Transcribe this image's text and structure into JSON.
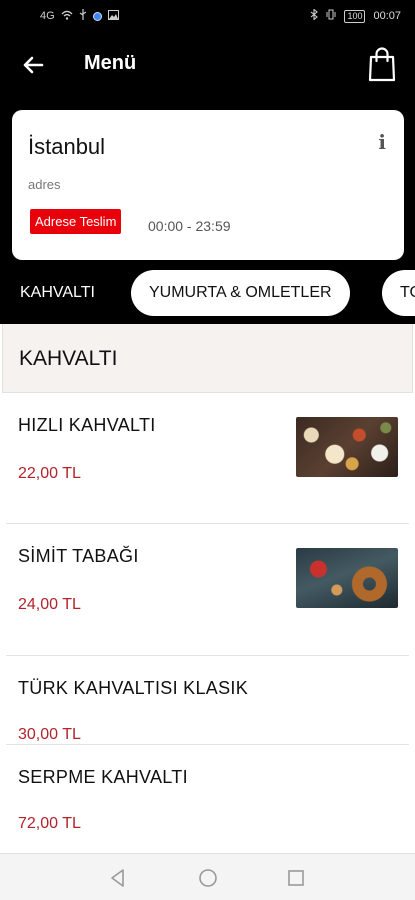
{
  "status_bar": {
    "left_icons": [
      "signal-icon",
      "wifi-icon",
      "usb-icon",
      "notification-dot-icon",
      "gallery-icon"
    ],
    "network_text": "4G",
    "battery_text": "100",
    "time": "00:07"
  },
  "header": {
    "title": "Menü"
  },
  "store": {
    "name": "İstanbul",
    "address": "adres",
    "delivery_badge": "Adrese Teslim",
    "hours": "00:00 - 23:59",
    "info_label": "i"
  },
  "categories": [
    {
      "label": "KAHVALTI",
      "active": true
    },
    {
      "label": "YUMURTA & OMLETLER",
      "active": false
    },
    {
      "label": "TO",
      "active": false
    }
  ],
  "section": {
    "title": "KAHVALTI"
  },
  "menu_items": [
    {
      "name": "HIZLI KAHVALTI",
      "price": "22,00 TL",
      "image": "breakfast-spread"
    },
    {
      "name": "SİMİT TABAĞI",
      "price": "24,00 TL",
      "image": "simit-and-tea"
    },
    {
      "name": "TÜRK KAHVALTISI KLASIK",
      "price": "30,00 TL",
      "image": null
    },
    {
      "name": "SERPME KAHVALTI",
      "price": "72,00 TL",
      "image": null
    }
  ],
  "colors": {
    "brand_red": "#e8000b",
    "price_red": "#b2232a",
    "header_bg": "#000000",
    "section_bg": "#f6f2ef"
  }
}
